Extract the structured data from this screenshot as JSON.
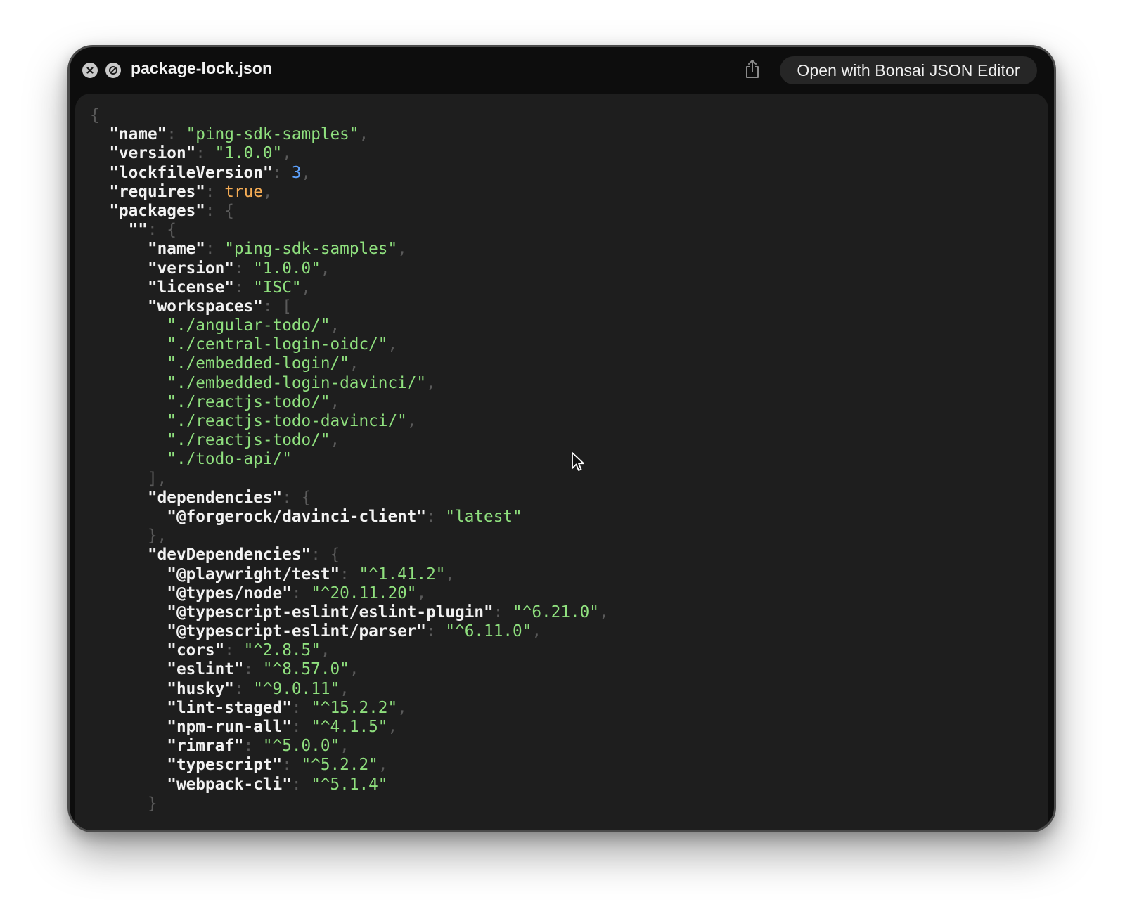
{
  "window": {
    "title": "package-lock.json",
    "open_button_label": "Open with Bonsai JSON Editor",
    "icons": {
      "close": "close-icon",
      "block": "block-icon",
      "share": "share-icon",
      "cursor": "pointer-cursor-icon"
    }
  },
  "colors": {
    "window_bg": "#0d0d0d",
    "content_bg": "#1e1e1e",
    "key": "#f2f2f2",
    "string": "#8fe07e",
    "number": "#5ea3ff",
    "boolean": "#f6ad55",
    "punctuation": "#5a5a5a"
  },
  "json_lines": [
    {
      "indent": 0,
      "open": "{"
    },
    {
      "indent": 1,
      "key": "\"name\"",
      "value": "\"ping-sdk-samples\"",
      "type": "string",
      "comma": true
    },
    {
      "indent": 1,
      "key": "\"version\"",
      "value": "\"1.0.0\"",
      "type": "string",
      "comma": true
    },
    {
      "indent": 1,
      "key": "\"lockfileVersion\"",
      "value": "3",
      "type": "number",
      "comma": true
    },
    {
      "indent": 1,
      "key": "\"requires\"",
      "value": "true",
      "type": "boolean",
      "comma": true
    },
    {
      "indent": 1,
      "key": "\"packages\"",
      "open": "{"
    },
    {
      "indent": 2,
      "key": "\"\"",
      "open": "{"
    },
    {
      "indent": 3,
      "key": "\"name\"",
      "value": "\"ping-sdk-samples\"",
      "type": "string",
      "comma": true
    },
    {
      "indent": 3,
      "key": "\"version\"",
      "value": "\"1.0.0\"",
      "type": "string",
      "comma": true
    },
    {
      "indent": 3,
      "key": "\"license\"",
      "value": "\"ISC\"",
      "type": "string",
      "comma": true
    },
    {
      "indent": 3,
      "key": "\"workspaces\"",
      "open": "["
    },
    {
      "indent": 4,
      "value": "\"./angular-todo/\"",
      "type": "string",
      "comma": true
    },
    {
      "indent": 4,
      "value": "\"./central-login-oidc/\"",
      "type": "string",
      "comma": true
    },
    {
      "indent": 4,
      "value": "\"./embedded-login/\"",
      "type": "string",
      "comma": true
    },
    {
      "indent": 4,
      "value": "\"./embedded-login-davinci/\"",
      "type": "string",
      "comma": true
    },
    {
      "indent": 4,
      "value": "\"./reactjs-todo/\"",
      "type": "string",
      "comma": true
    },
    {
      "indent": 4,
      "value": "\"./reactjs-todo-davinci/\"",
      "type": "string",
      "comma": true
    },
    {
      "indent": 4,
      "value": "\"./reactjs-todo/\"",
      "type": "string",
      "comma": true
    },
    {
      "indent": 4,
      "value": "\"./todo-api/\"",
      "type": "string",
      "comma": false
    },
    {
      "indent": 3,
      "close": "]",
      "comma": true
    },
    {
      "indent": 3,
      "key": "\"dependencies\"",
      "open": "{"
    },
    {
      "indent": 4,
      "key": "\"@forgerock/davinci-client\"",
      "value": "\"latest\"",
      "type": "string",
      "comma": false
    },
    {
      "indent": 3,
      "close": "}",
      "comma": true
    },
    {
      "indent": 3,
      "key": "\"devDependencies\"",
      "open": "{"
    },
    {
      "indent": 4,
      "key": "\"@playwright/test\"",
      "value": "\"^1.41.2\"",
      "type": "string",
      "comma": true
    },
    {
      "indent": 4,
      "key": "\"@types/node\"",
      "value": "\"^20.11.20\"",
      "type": "string",
      "comma": true
    },
    {
      "indent": 4,
      "key": "\"@typescript-eslint/eslint-plugin\"",
      "value": "\"^6.21.0\"",
      "type": "string",
      "comma": true
    },
    {
      "indent": 4,
      "key": "\"@typescript-eslint/parser\"",
      "value": "\"^6.11.0\"",
      "type": "string",
      "comma": true
    },
    {
      "indent": 4,
      "key": "\"cors\"",
      "value": "\"^2.8.5\"",
      "type": "string",
      "comma": true
    },
    {
      "indent": 4,
      "key": "\"eslint\"",
      "value": "\"^8.57.0\"",
      "type": "string",
      "comma": true
    },
    {
      "indent": 4,
      "key": "\"husky\"",
      "value": "\"^9.0.11\"",
      "type": "string",
      "comma": true
    },
    {
      "indent": 4,
      "key": "\"lint-staged\"",
      "value": "\"^15.2.2\"",
      "type": "string",
      "comma": true
    },
    {
      "indent": 4,
      "key": "\"npm-run-all\"",
      "value": "\"^4.1.5\"",
      "type": "string",
      "comma": true
    },
    {
      "indent": 4,
      "key": "\"rimraf\"",
      "value": "\"^5.0.0\"",
      "type": "string",
      "comma": true
    },
    {
      "indent": 4,
      "key": "\"typescript\"",
      "value": "\"^5.2.2\"",
      "type": "string",
      "comma": true
    },
    {
      "indent": 4,
      "key": "\"webpack-cli\"",
      "value": "\"^5.1.4\"",
      "type": "string",
      "comma": false
    },
    {
      "indent": 3,
      "close": "}",
      "comma": false
    }
  ]
}
